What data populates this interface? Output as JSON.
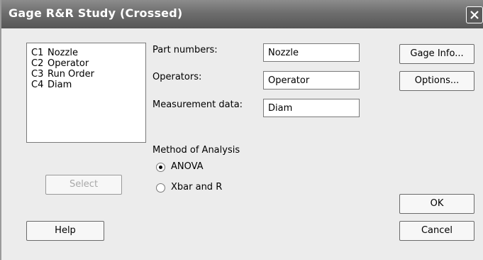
{
  "window": {
    "title": "Gage R&R Study (Crossed)"
  },
  "column_list": [
    {
      "num": "C1",
      "name": "Nozzle"
    },
    {
      "num": "C2",
      "name": "Operator"
    },
    {
      "num": "C3",
      "name": "Run Order"
    },
    {
      "num": "C4",
      "name": "Diam"
    }
  ],
  "fields": {
    "part_numbers": {
      "label": "Part numbers:",
      "value": "Nozzle"
    },
    "operators": {
      "label": "Operators:",
      "value": "Operator"
    },
    "measurement_data": {
      "label": "Measurement data:",
      "value": "Diam"
    }
  },
  "method": {
    "label": "Method of Analysis",
    "options": [
      {
        "label": "ANOVA",
        "checked": true
      },
      {
        "label": "Xbar and R",
        "checked": false
      }
    ]
  },
  "buttons": {
    "gage_info": "Gage Info...",
    "options": "Options...",
    "select": "Select",
    "help": "Help",
    "ok": "OK",
    "cancel": "Cancel"
  }
}
